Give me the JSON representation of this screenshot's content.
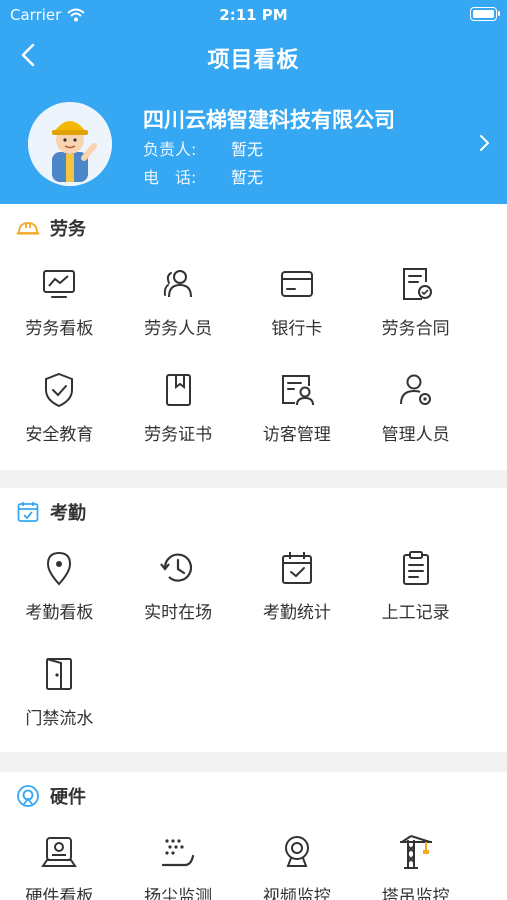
{
  "status_bar": {
    "carrier": "Carrier",
    "time": "2:11 PM"
  },
  "nav": {
    "title": "项目看板"
  },
  "company": {
    "name": "四川云梯智建科技有限公司",
    "manager_label": "负责人:",
    "manager_value": "暂无",
    "phone_label": "电　话:",
    "phone_value": "暂无"
  },
  "sections": [
    {
      "title": "劳务",
      "items": [
        {
          "label": "劳务看板",
          "icon": "monitor-chart-icon"
        },
        {
          "label": "劳务人员",
          "icon": "people-icon"
        },
        {
          "label": "银行卡",
          "icon": "bank-card-icon"
        },
        {
          "label": "劳务合同",
          "icon": "contract-icon"
        },
        {
          "label": "安全教育",
          "icon": "shield-check-icon"
        },
        {
          "label": "劳务证书",
          "icon": "certificate-book-icon"
        },
        {
          "label": "访客管理",
          "icon": "visitor-icon"
        },
        {
          "label": "管理人员",
          "icon": "user-gear-icon"
        }
      ]
    },
    {
      "title": "考勤",
      "items": [
        {
          "label": "考勤看板",
          "icon": "location-pin-icon"
        },
        {
          "label": "实时在场",
          "icon": "history-clock-icon"
        },
        {
          "label": "考勤统计",
          "icon": "calendar-check-icon"
        },
        {
          "label": "上工记录",
          "icon": "clipboard-icon"
        },
        {
          "label": "门禁流水",
          "icon": "door-icon"
        }
      ]
    },
    {
      "title": "硬件",
      "items": [
        {
          "label": "硬件看板",
          "icon": "device-icon"
        },
        {
          "label": "扬尘监测",
          "icon": "dust-icon"
        },
        {
          "label": "视频监控",
          "icon": "camera-icon"
        },
        {
          "label": "塔吊监控",
          "icon": "tower-crane-icon"
        }
      ]
    }
  ],
  "colors": {
    "header": "#35a7f3",
    "accent_orange": "#f5a623",
    "accent_blue": "#35a7f3"
  }
}
